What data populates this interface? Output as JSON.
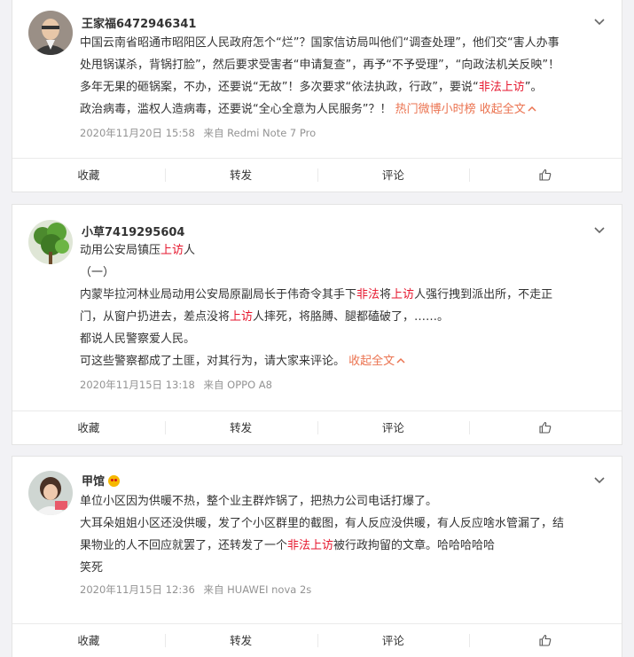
{
  "posts": [
    {
      "username": "王家福6472946341",
      "lines": [
        [
          "中国云南省昭通市昭阳区人民政府怎个“烂”？国家信访局叫他们“调查处理”，他们交“害人办事"
        ],
        [
          "处甩锅谋杀，背锅打脸”，然后要求受害者“申请复查”，再予“不予受理”，“向政法机关反映”！"
        ],
        [
          "多年无果的砸锅案，不办，还要说“无故”！多次要求“依法执政，行政”，要说“",
          "非法上访",
          "”。"
        ],
        [
          "政治病毒，滥权人造病毒，还要说“全心全意为人民服务”？！ "
        ]
      ],
      "hot_link": "热门微博小时榜",
      "collapse": "收起全文",
      "date": "2020年11月20日 15:58",
      "source": "来自 Redmi Note 7 Pro"
    },
    {
      "username": "小草7419295604",
      "line1_a": "动用公安局镇压",
      "line1_red": "上访",
      "line1_b": "人",
      "line2": "（一）",
      "line3_a": "内蒙毕拉河林业局动用公安局原副局长于伟奇令其手下",
      "line3_red1": "非法",
      "line3_b": "将",
      "line3_red2": "上访",
      "line3_c": "人强行拽到派出所，不走正",
      "line4_a": "门，从窗户扔进去，差点没将",
      "line4_red": "上访",
      "line4_b": "人摔死，将胳膊、腿都磕破了，……。",
      "line5": "都说人民警察爱人民。",
      "line6": "可这些警察都成了土匪，对其行为，请大家来评论。",
      "collapse": "收起全文",
      "date": "2020年11月15日 13:18",
      "source": "来自 OPPO A8"
    },
    {
      "username": "甲馆",
      "line1": "单位小区因为供暖不热，整个业主群炸锅了，把热力公司电话打爆了。",
      "line2": "大耳朵姐姐小区还没供暖，发了个小区群里的截图，有人反应没供暖，有人反应啥水管漏了，结",
      "line3_a": "果物业的人不回应就罢了，还转发了一个",
      "line3_red": "非法上访",
      "line3_b": "被行政拘留的文章。哈哈哈哈哈",
      "line4": "笑死",
      "date": "2020年11月15日 12:36",
      "source": "来自 HUAWEI nova 2s"
    }
  ],
  "actions": {
    "favorite": "收藏",
    "repost": "转发",
    "comment": "评论"
  },
  "icons": {
    "chevron": "chevron-down-icon",
    "like": "thumbs-up-icon",
    "collapse_arrow": "chevron-up-icon"
  }
}
